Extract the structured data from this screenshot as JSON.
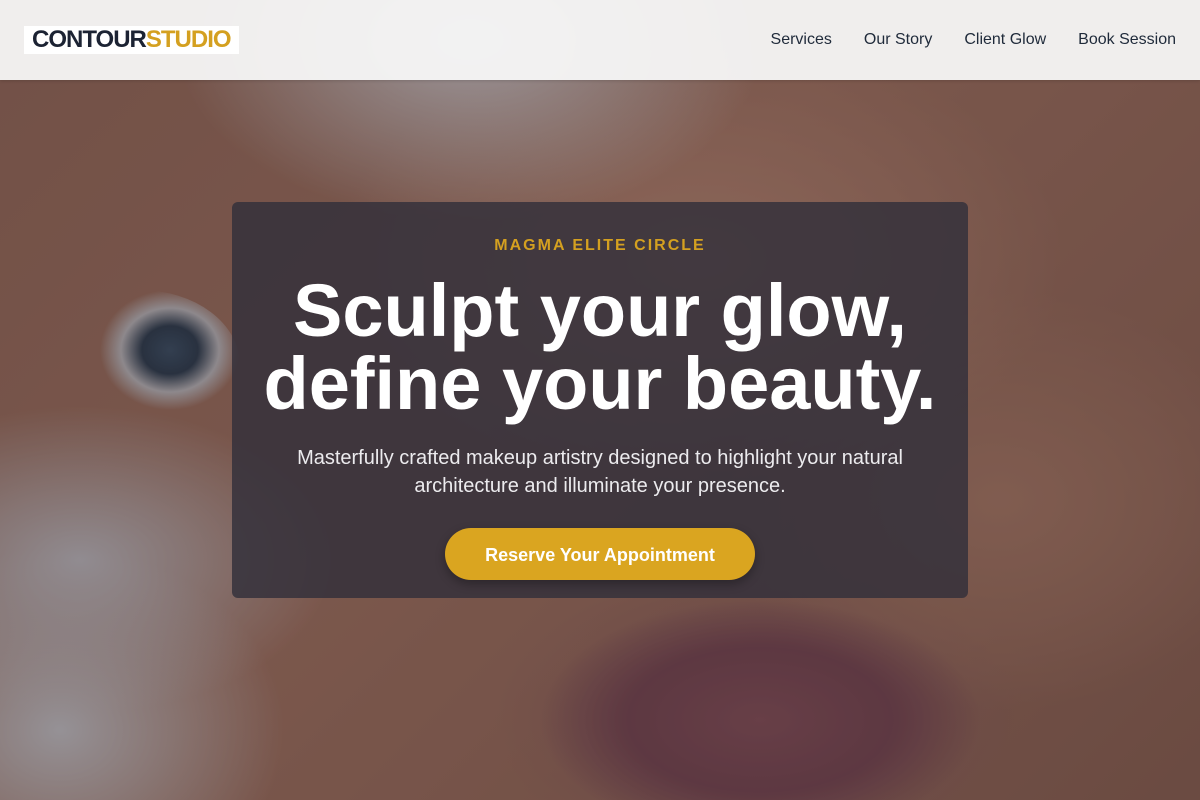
{
  "header": {
    "logo_part1": "CONTOUR",
    "logo_part2": "STUDIO",
    "nav": [
      {
        "label": "Services"
      },
      {
        "label": "Our Story"
      },
      {
        "label": "Client Glow"
      },
      {
        "label": "Book Session"
      }
    ]
  },
  "hero": {
    "eyebrow": "MAGMA ELITE CIRCLE",
    "headline_line1": "Sculpt your glow,",
    "headline_line2": "define your beauty.",
    "subtitle": "Masterfully crafted makeup artistry designed to highlight your natural architecture and illuminate your presence.",
    "cta_label": "Reserve Your Appointment"
  },
  "colors": {
    "accent": "#daa520",
    "logo_dark": "#1c2333",
    "card_bg": "#32303a"
  }
}
